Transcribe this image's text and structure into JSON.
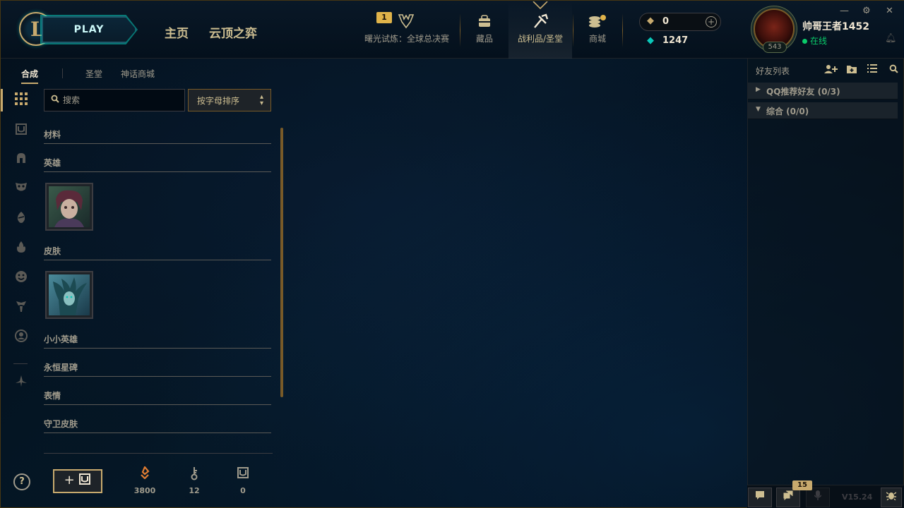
{
  "header": {
    "play_label": "PLAY",
    "nav_home": "主页",
    "nav_tft": "云顶之弈",
    "tournament_badge": "1",
    "tournament_label": "曙光试炼：全球总决赛",
    "collection_label": "藏品",
    "loot_label": "战利品/圣堂",
    "store_label": "商城",
    "rp_value": "0",
    "be_value": "1247",
    "username": "帅哥王者1452",
    "status": "在线",
    "level": "543"
  },
  "window_controls": {
    "minimize": "—",
    "settings": "⚙",
    "close": "✕"
  },
  "subtabs": [
    "合成",
    "圣堂",
    "神话商城"
  ],
  "crafting": {
    "search_placeholder": "搜索",
    "sort_label": "按字母排序",
    "categories": {
      "materials": "材料",
      "champions": "英雄",
      "skins": "皮肤",
      "little_legends": "小小英雄",
      "eternals": "永恒星碑",
      "emotes": "表情",
      "ward_skins": "守卫皮肤"
    },
    "resources": {
      "orange_essence": "3800",
      "keys": "12",
      "chests": "0"
    }
  },
  "friends": {
    "title": "好友列表",
    "groups": [
      {
        "label": "QQ推荐好友 (0/3)",
        "expanded": false
      },
      {
        "label": "综合 (0/0)",
        "expanded": true
      }
    ]
  },
  "footer": {
    "missions_badge": "15",
    "version": "V15.24"
  },
  "colors": {
    "gold": "#c8aa6e",
    "teal": "#0ac8b9",
    "online": "#0acb6a",
    "orange_essence": "#e07c32"
  },
  "icons": {
    "rail": [
      "grid-icon",
      "chest-icon",
      "helmet-icon",
      "mask-icon",
      "egg-icon",
      "flame-icon",
      "emote-icon",
      "ward-icon",
      "profile-icon",
      "eternals-icon"
    ]
  }
}
